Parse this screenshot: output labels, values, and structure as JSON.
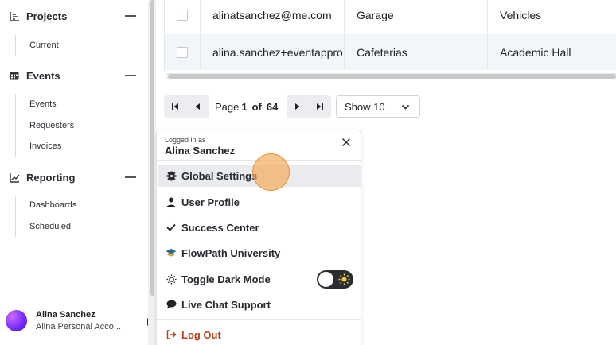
{
  "sidebar": {
    "sections": [
      {
        "label": "Projects",
        "icon": "chart-icon",
        "items": [
          "Current"
        ]
      },
      {
        "label": "Events",
        "icon": "calendar-icon",
        "items": [
          "Events",
          "Requesters",
          "Invoices"
        ]
      },
      {
        "label": "Reporting",
        "icon": "line-chart-icon",
        "items": [
          "Dashboards",
          "Scheduled"
        ]
      }
    ],
    "user": {
      "name": "Alina Sanchez",
      "org": "Alina Personal Acco..."
    }
  },
  "table": {
    "rows": [
      {
        "email": "alinatsanchez@me.com",
        "location": "Garage",
        "type": "Vehicles"
      },
      {
        "email": "alina.sanchez+eventappro",
        "location": "Cafeterias",
        "type": "Academic Hall"
      }
    ]
  },
  "pager": {
    "prefix": "Page",
    "current": "1",
    "of_label": "of",
    "total": "64",
    "show_value": "Show 10"
  },
  "menu": {
    "logged_in_label": "Logged in as",
    "user_name": "Alina Sanchez",
    "items": [
      {
        "label": "Global Settings",
        "icon": "gear-icon"
      },
      {
        "label": "User Profile",
        "icon": "user-icon"
      },
      {
        "label": "Success Center",
        "icon": "check-icon"
      },
      {
        "label": "FlowPath University",
        "icon": "graduation-cap-icon"
      },
      {
        "label": "Toggle Dark Mode",
        "icon": "sun-icon"
      },
      {
        "label": "Live Chat Support",
        "icon": "chat-bubble-icon"
      },
      {
        "label": "Log Out",
        "icon": "logout-icon"
      }
    ]
  },
  "colors": {
    "logout": "#b8421a",
    "click_indicator": "#f5a650",
    "toggle_bg": "#2a2d33"
  }
}
